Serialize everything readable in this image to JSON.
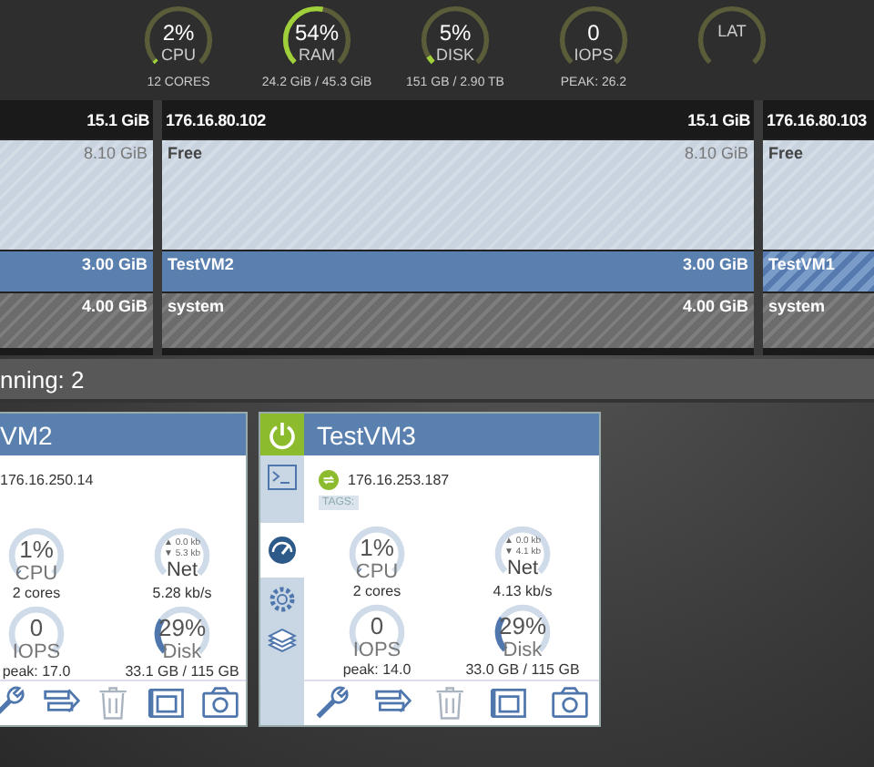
{
  "summary": [
    {
      "value": "2%",
      "label": "CPU",
      "sub": "12 CORES",
      "level": 0.02
    },
    {
      "value": "54%",
      "label": "RAM",
      "sub": "24.2 GiB / 45.3 GiB",
      "level": 0.54
    },
    {
      "value": "5%",
      "label": "DISK",
      "sub": "151 GB / 2.90 TB",
      "level": 0.05
    },
    {
      "value": "0",
      "label": "IOPS",
      "sub": "PEAK: 26.2"
    },
    {
      "label": "LAT"
    }
  ],
  "hosts": [
    {
      "size": "15.1 GiB",
      "segments": [
        {
          "kind": "free",
          "size": "8.10 GiB"
        },
        {
          "kind": "vm",
          "size": "3.00 GiB",
          "hatched": false
        },
        {
          "kind": "system",
          "size": "4.00 GiB"
        }
      ]
    },
    {
      "name": "176.16.80.102",
      "size": "15.1 GiB",
      "segments": [
        {
          "kind": "free",
          "label": "Free",
          "size": "8.10 GiB"
        },
        {
          "kind": "vm",
          "label": "TestVM2",
          "size": "3.00 GiB",
          "hatched": false
        },
        {
          "kind": "system",
          "label": "system",
          "size": "4.00 GiB"
        }
      ]
    },
    {
      "name": "176.16.80.103",
      "segments": [
        {
          "kind": "free",
          "label": "Free"
        },
        {
          "kind": "vm",
          "label": "TestVM1",
          "hatched": true
        },
        {
          "kind": "system",
          "label": "system"
        }
      ]
    }
  ],
  "status": "nning: 2",
  "cards": [
    {
      "title": "VM2",
      "ip": "176.16.250.14",
      "metrics": [
        {
          "kind": "cpu",
          "value": "1%",
          "label": "CPU",
          "sub": "2 cores",
          "level": 0.01
        },
        {
          "kind": "net",
          "up": "▲ 0.0 kb",
          "down": "▼ 5.3 kb",
          "label": "Net",
          "sub": "5.28 kb/s"
        },
        {
          "kind": "iops",
          "value": "0",
          "label": "IOPS",
          "sub": "peak: 17.0"
        },
        {
          "kind": "disk",
          "value": "29%",
          "label": "Disk",
          "sub": "33.1 GB / 115 GB",
          "level": 0.29
        }
      ],
      "actions": [
        {
          "kind": "wrench",
          "disabled": false
        },
        {
          "kind": "migrate",
          "disabled": false
        },
        {
          "kind": "trash",
          "disabled": true
        },
        {
          "kind": "snapshot",
          "disabled": false
        },
        {
          "kind": "camera",
          "disabled": false
        }
      ]
    },
    {
      "title": "TestVM3",
      "ip": "176.16.253.187",
      "tags": "TAGS:",
      "sidebar": [
        {
          "kind": "power",
          "on": true,
          "selected": false
        },
        {
          "kind": "console",
          "on": false,
          "selected": false
        },
        {
          "kind": "stats",
          "on": false,
          "selected": true
        },
        {
          "kind": "gear",
          "on": false,
          "selected": false
        },
        {
          "kind": "layers",
          "on": false,
          "selected": false
        }
      ],
      "metrics": [
        {
          "kind": "cpu",
          "value": "1%",
          "label": "CPU",
          "sub": "2 cores",
          "level": 0.01
        },
        {
          "kind": "net",
          "up": "▲ 0.0 kb",
          "down": "▼ 4.1 kb",
          "label": "Net",
          "sub": "4.13 kb/s"
        },
        {
          "kind": "iops",
          "value": "0",
          "label": "IOPS",
          "sub": "peak: 14.0"
        },
        {
          "kind": "disk",
          "value": "29%",
          "label": "Disk",
          "sub": "33.0 GB / 115 GB",
          "level": 0.29
        }
      ],
      "actions": [
        {
          "kind": "wrench",
          "disabled": false
        },
        {
          "kind": "migrate",
          "disabled": false
        },
        {
          "kind": "trash",
          "disabled": true
        },
        {
          "kind": "snapshot",
          "disabled": false
        },
        {
          "kind": "camera",
          "disabled": false
        }
      ]
    }
  ]
}
